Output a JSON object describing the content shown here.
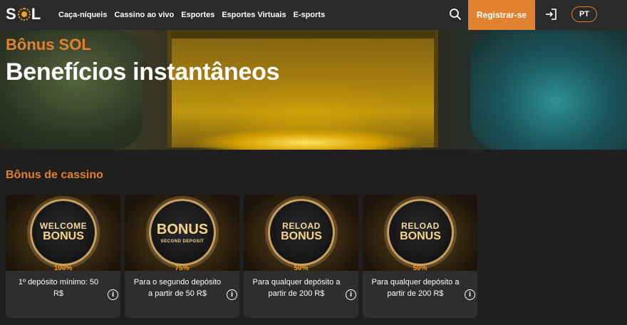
{
  "header": {
    "logo": "SOL",
    "nav": [
      {
        "label": "Caça-níqueis"
      },
      {
        "label": "Cassino ao vivo"
      },
      {
        "label": "Esportes"
      },
      {
        "label": "Esportes Virtuais"
      },
      {
        "label": "E-sports"
      }
    ],
    "register_label": "Registrar-se",
    "language": "PT",
    "icons": {
      "search": "search-icon",
      "login": "login-icon"
    }
  },
  "hero": {
    "kicker": "Bônus SOL",
    "title": "Benefícios instantâneos"
  },
  "section": {
    "title": "Bônus de cassino"
  },
  "cards": [
    {
      "medal_line1": "WELCOME",
      "medal_line2": "BONUS",
      "medal_sub": "",
      "percent": "100%",
      "desc": "1º depósito mínimo: 50 R$"
    },
    {
      "medal_line1": "",
      "medal_line2": "BONUS",
      "medal_sub": "SECOND DEPOSIT",
      "percent": "75%",
      "desc": "Para o segundo depósito a partir de 50 R$"
    },
    {
      "medal_line1": "RELOAD",
      "medal_line2": "BONUS",
      "medal_sub": "",
      "percent": "50%",
      "desc": "Para qualquer depósito a partir de 200 R$"
    },
    {
      "medal_line1": "RELOAD",
      "medal_line2": "BONUS",
      "medal_sub": "",
      "percent": "50%",
      "desc": "Para qualquer depósito a partir de 200 R$"
    }
  ],
  "colors": {
    "accent": "#e0822f",
    "background": "#1f1f1f",
    "topbar": "#2a2a2a",
    "card": "#2e2e2e"
  }
}
